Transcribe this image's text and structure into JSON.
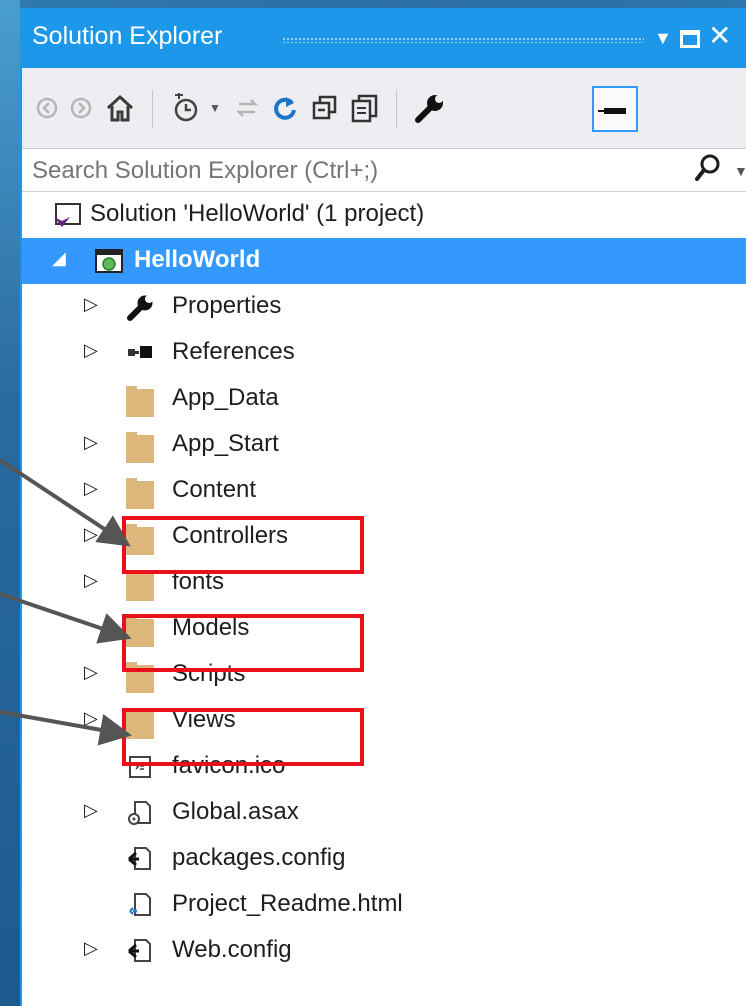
{
  "window": {
    "title": "Solution Explorer"
  },
  "toolbar": {
    "buttons": [
      {
        "name": "back-button",
        "icon": "back-arrow-icon"
      },
      {
        "name": "forward-button",
        "icon": "forward-arrow-icon"
      },
      {
        "name": "home-button",
        "icon": "home-icon"
      },
      {
        "name": "pending-changes-filter-button",
        "icon": "history-icon"
      },
      {
        "name": "sync-with-active-document-button",
        "icon": "sync-icon"
      },
      {
        "name": "refresh-button",
        "icon": "refresh-icon"
      },
      {
        "name": "collapse-all-button",
        "icon": "collapse-all-icon"
      },
      {
        "name": "show-all-files-button",
        "icon": "show-all-files-icon"
      },
      {
        "name": "properties-button",
        "icon": "wrench-icon"
      },
      {
        "name": "preview-selected-items-button",
        "icon": "pin-icon"
      }
    ]
  },
  "search": {
    "placeholder": "Search Solution Explorer (Ctrl+;)"
  },
  "tree": {
    "solution": "Solution 'HelloWorld' (1 project)",
    "project": "HelloWorld",
    "items": [
      {
        "label": "Properties",
        "icon": "wrench-icon",
        "expandable": true
      },
      {
        "label": "References",
        "icon": "references-icon",
        "expandable": true
      },
      {
        "label": "App_Data",
        "icon": "folder-icon",
        "expandable": false
      },
      {
        "label": "App_Start",
        "icon": "folder-icon",
        "expandable": true
      },
      {
        "label": "Content",
        "icon": "folder-icon",
        "expandable": true
      },
      {
        "label": "Controllers",
        "icon": "folder-icon",
        "expandable": true,
        "highlighted": true
      },
      {
        "label": "fonts",
        "icon": "folder-icon",
        "expandable": true
      },
      {
        "label": "Models",
        "icon": "folder-icon",
        "expandable": false,
        "highlighted": true
      },
      {
        "label": "Scripts",
        "icon": "folder-icon",
        "expandable": true
      },
      {
        "label": "Views",
        "icon": "folder-icon",
        "expandable": true,
        "highlighted": true
      },
      {
        "label": "favicon.ico",
        "icon": "icon-file-icon",
        "expandable": false
      },
      {
        "label": "Global.asax",
        "icon": "asax-file-icon",
        "expandable": true
      },
      {
        "label": "packages.config",
        "icon": "config-file-icon",
        "expandable": false
      },
      {
        "label": "Project_Readme.html",
        "icon": "html-file-icon",
        "expandable": false
      },
      {
        "label": "Web.config",
        "icon": "config-file-icon",
        "expandable": true
      }
    ]
  },
  "colors": {
    "accent": "#1c97ea",
    "selection": "#3399ff",
    "highlight_box": "#e8101a",
    "folder": "#dcb67a",
    "arrow": "#555555"
  }
}
